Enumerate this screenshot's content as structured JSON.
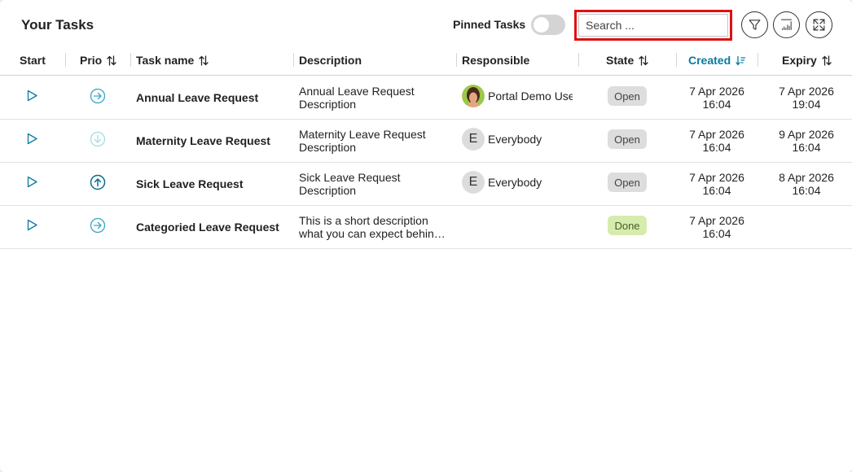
{
  "header": {
    "title": "Your Tasks",
    "pinned_label": "Pinned Tasks",
    "search_placeholder": "Search ..."
  },
  "icons": {
    "filter": "funnel-icon",
    "columns": "bar-chart-icon",
    "expand": "expand-icon"
  },
  "columns": {
    "start": "Start",
    "prio": "Prio",
    "task_name": "Task name",
    "description": "Description",
    "responsible": "Responsible",
    "state": "State",
    "created": "Created",
    "expiry": "Expiry"
  },
  "colors": {
    "accent": "#0b7a9e",
    "done_badge": "#d6ecae",
    "open_badge": "#dddddd",
    "search_highlight": "#e01010"
  },
  "rows": [
    {
      "prio": "normal",
      "name": "Annual Leave Request",
      "desc1": "Annual Leave Request",
      "desc2": "Description",
      "responsible": "Portal Demo User",
      "avatar": "photo",
      "state": "Open",
      "created1": "7 Apr 2026",
      "created2": "16:04",
      "expiry1": "7 Apr 2026",
      "expiry2": "19:04"
    },
    {
      "prio": "low",
      "name": "Maternity Leave Request",
      "desc1": "Maternity Leave Request",
      "desc2": "Description",
      "responsible": "Everybody",
      "avatar_letter": "E",
      "state": "Open",
      "created1": "7 Apr 2026",
      "created2": "16:04",
      "expiry1": "9 Apr 2026",
      "expiry2": "16:04"
    },
    {
      "prio": "high",
      "name": "Sick Leave Request",
      "desc1": "Sick Leave Request",
      "desc2": "Description",
      "responsible": "Everybody",
      "avatar_letter": "E",
      "state": "Open",
      "created1": "7 Apr 2026",
      "created2": "16:04",
      "expiry1": "8 Apr 2026",
      "expiry2": "16:04"
    },
    {
      "prio": "normal",
      "name": "Categoried Leave Request",
      "desc1": "This is a short description",
      "desc2": "what you can expect behind this task.",
      "responsible": "",
      "state": "Done",
      "created1": "7 Apr 2026",
      "created2": "16:04",
      "expiry1": "",
      "expiry2": ""
    }
  ]
}
